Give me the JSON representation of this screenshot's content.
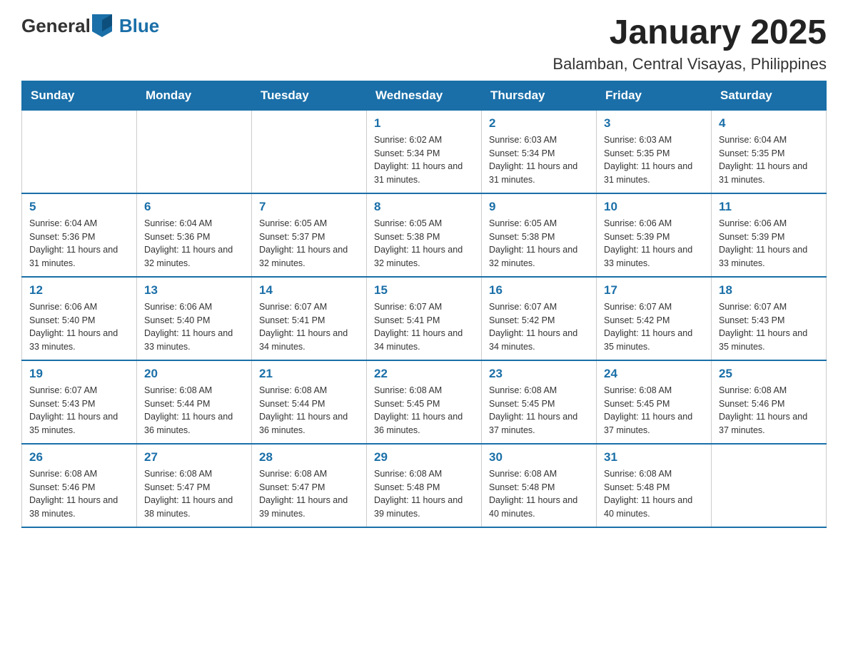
{
  "header": {
    "logo": {
      "text_general": "General",
      "text_blue": "Blue",
      "arrow_color": "#1a6fa8"
    },
    "title": "January 2025",
    "subtitle": "Balamban, Central Visayas, Philippines"
  },
  "days_of_week": [
    "Sunday",
    "Monday",
    "Tuesday",
    "Wednesday",
    "Thursday",
    "Friday",
    "Saturday"
  ],
  "weeks": [
    {
      "days": [
        {
          "number": "",
          "info": ""
        },
        {
          "number": "",
          "info": ""
        },
        {
          "number": "",
          "info": ""
        },
        {
          "number": "1",
          "info": "Sunrise: 6:02 AM\nSunset: 5:34 PM\nDaylight: 11 hours and 31 minutes."
        },
        {
          "number": "2",
          "info": "Sunrise: 6:03 AM\nSunset: 5:34 PM\nDaylight: 11 hours and 31 minutes."
        },
        {
          "number": "3",
          "info": "Sunrise: 6:03 AM\nSunset: 5:35 PM\nDaylight: 11 hours and 31 minutes."
        },
        {
          "number": "4",
          "info": "Sunrise: 6:04 AM\nSunset: 5:35 PM\nDaylight: 11 hours and 31 minutes."
        }
      ]
    },
    {
      "days": [
        {
          "number": "5",
          "info": "Sunrise: 6:04 AM\nSunset: 5:36 PM\nDaylight: 11 hours and 31 minutes."
        },
        {
          "number": "6",
          "info": "Sunrise: 6:04 AM\nSunset: 5:36 PM\nDaylight: 11 hours and 32 minutes."
        },
        {
          "number": "7",
          "info": "Sunrise: 6:05 AM\nSunset: 5:37 PM\nDaylight: 11 hours and 32 minutes."
        },
        {
          "number": "8",
          "info": "Sunrise: 6:05 AM\nSunset: 5:38 PM\nDaylight: 11 hours and 32 minutes."
        },
        {
          "number": "9",
          "info": "Sunrise: 6:05 AM\nSunset: 5:38 PM\nDaylight: 11 hours and 32 minutes."
        },
        {
          "number": "10",
          "info": "Sunrise: 6:06 AM\nSunset: 5:39 PM\nDaylight: 11 hours and 33 minutes."
        },
        {
          "number": "11",
          "info": "Sunrise: 6:06 AM\nSunset: 5:39 PM\nDaylight: 11 hours and 33 minutes."
        }
      ]
    },
    {
      "days": [
        {
          "number": "12",
          "info": "Sunrise: 6:06 AM\nSunset: 5:40 PM\nDaylight: 11 hours and 33 minutes."
        },
        {
          "number": "13",
          "info": "Sunrise: 6:06 AM\nSunset: 5:40 PM\nDaylight: 11 hours and 33 minutes."
        },
        {
          "number": "14",
          "info": "Sunrise: 6:07 AM\nSunset: 5:41 PM\nDaylight: 11 hours and 34 minutes."
        },
        {
          "number": "15",
          "info": "Sunrise: 6:07 AM\nSunset: 5:41 PM\nDaylight: 11 hours and 34 minutes."
        },
        {
          "number": "16",
          "info": "Sunrise: 6:07 AM\nSunset: 5:42 PM\nDaylight: 11 hours and 34 minutes."
        },
        {
          "number": "17",
          "info": "Sunrise: 6:07 AM\nSunset: 5:42 PM\nDaylight: 11 hours and 35 minutes."
        },
        {
          "number": "18",
          "info": "Sunrise: 6:07 AM\nSunset: 5:43 PM\nDaylight: 11 hours and 35 minutes."
        }
      ]
    },
    {
      "days": [
        {
          "number": "19",
          "info": "Sunrise: 6:07 AM\nSunset: 5:43 PM\nDaylight: 11 hours and 35 minutes."
        },
        {
          "number": "20",
          "info": "Sunrise: 6:08 AM\nSunset: 5:44 PM\nDaylight: 11 hours and 36 minutes."
        },
        {
          "number": "21",
          "info": "Sunrise: 6:08 AM\nSunset: 5:44 PM\nDaylight: 11 hours and 36 minutes."
        },
        {
          "number": "22",
          "info": "Sunrise: 6:08 AM\nSunset: 5:45 PM\nDaylight: 11 hours and 36 minutes."
        },
        {
          "number": "23",
          "info": "Sunrise: 6:08 AM\nSunset: 5:45 PM\nDaylight: 11 hours and 37 minutes."
        },
        {
          "number": "24",
          "info": "Sunrise: 6:08 AM\nSunset: 5:45 PM\nDaylight: 11 hours and 37 minutes."
        },
        {
          "number": "25",
          "info": "Sunrise: 6:08 AM\nSunset: 5:46 PM\nDaylight: 11 hours and 37 minutes."
        }
      ]
    },
    {
      "days": [
        {
          "number": "26",
          "info": "Sunrise: 6:08 AM\nSunset: 5:46 PM\nDaylight: 11 hours and 38 minutes."
        },
        {
          "number": "27",
          "info": "Sunrise: 6:08 AM\nSunset: 5:47 PM\nDaylight: 11 hours and 38 minutes."
        },
        {
          "number": "28",
          "info": "Sunrise: 6:08 AM\nSunset: 5:47 PM\nDaylight: 11 hours and 39 minutes."
        },
        {
          "number": "29",
          "info": "Sunrise: 6:08 AM\nSunset: 5:48 PM\nDaylight: 11 hours and 39 minutes."
        },
        {
          "number": "30",
          "info": "Sunrise: 6:08 AM\nSunset: 5:48 PM\nDaylight: 11 hours and 40 minutes."
        },
        {
          "number": "31",
          "info": "Sunrise: 6:08 AM\nSunset: 5:48 PM\nDaylight: 11 hours and 40 minutes."
        },
        {
          "number": "",
          "info": ""
        }
      ]
    }
  ]
}
